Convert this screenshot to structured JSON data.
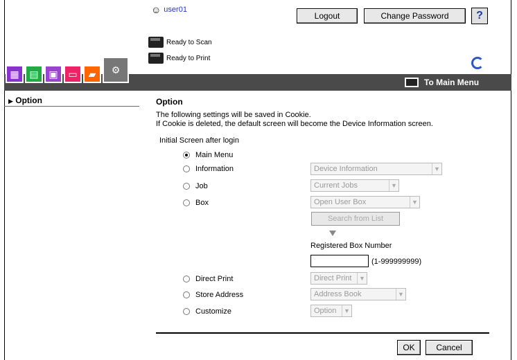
{
  "header": {
    "user_name": "user01",
    "logout_label": "Logout",
    "change_password_label": "Change Password",
    "help_label": "?"
  },
  "status": {
    "scan": "Ready to Scan",
    "print": "Ready to Print"
  },
  "toolbar": {
    "main_menu_label": "To Main Menu"
  },
  "sidebar": {
    "items": [
      {
        "label": "Option",
        "arrow": "▶"
      }
    ]
  },
  "main": {
    "title": "Option",
    "desc_line1": "The following settings will be saved in Cookie.",
    "desc_line2": "If Cookie is deleted, the default screen will become the Device Information screen.",
    "initial_screen_label": "Initial Screen after login",
    "options": [
      {
        "label": "Main Menu",
        "selected": true
      },
      {
        "label": "Information",
        "selected": false,
        "select": "Device Information"
      },
      {
        "label": "Job",
        "selected": false,
        "select": "Current Jobs"
      },
      {
        "label": "Box",
        "selected": false,
        "select": "Open User Box"
      },
      {
        "label": "Direct Print",
        "selected": false,
        "select": "Direct Print"
      },
      {
        "label": "Store Address",
        "selected": false,
        "select": "Address Book"
      },
      {
        "label": "Customize",
        "selected": false,
        "select": "Option"
      }
    ],
    "search_from_list_label": "Search from List",
    "registered_box_label": "Registered Box Number",
    "box_number_value": "",
    "box_range": "(1-999999999)",
    "ok_label": "OK",
    "cancel_label": "Cancel"
  },
  "colors": {
    "toolbar_bg": "#4a4a4a",
    "user_link": "#2233cc",
    "tab_colors": [
      "#8833cc",
      "#22aa44",
      "#9944cc",
      "#ee2266",
      "#ff6600",
      "#777777"
    ]
  }
}
